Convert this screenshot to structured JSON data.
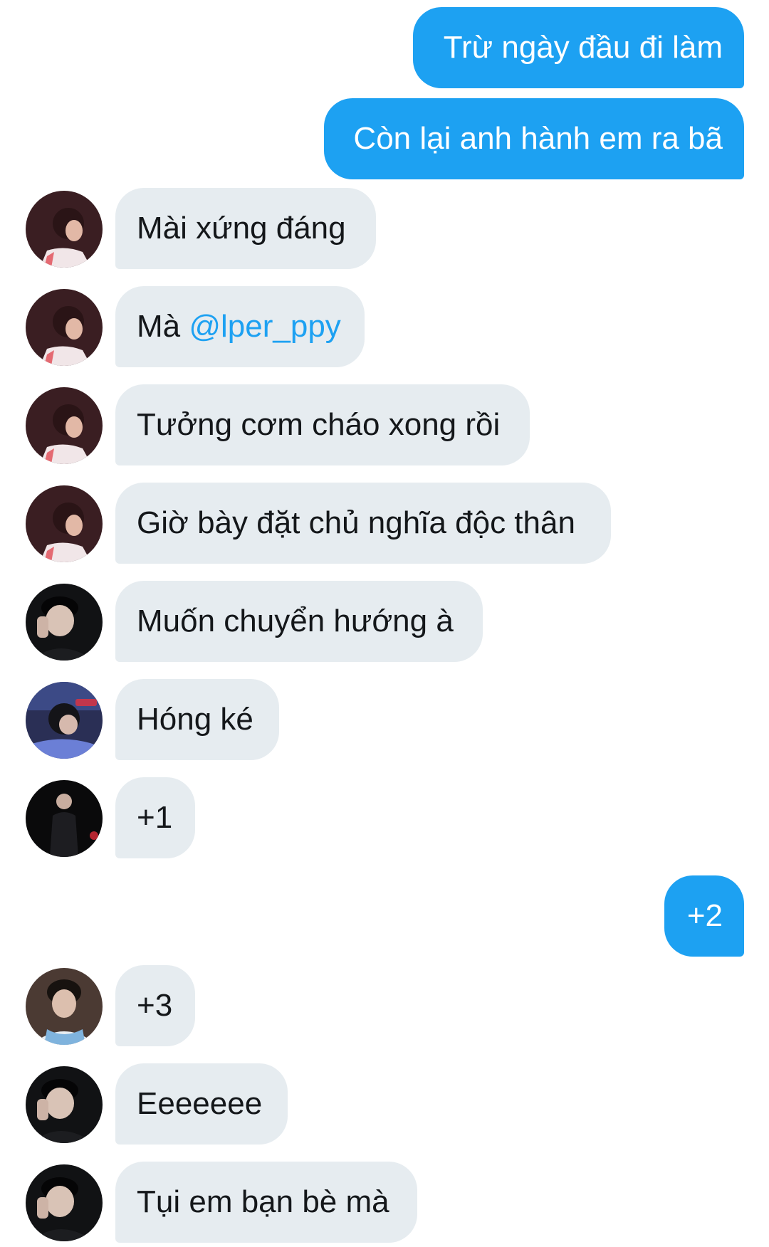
{
  "messages": [
    {
      "side": "out",
      "text": "Trừ ngày đầu đi làm"
    },
    {
      "side": "out",
      "text": "Còn lại anh hành em ra bã"
    },
    {
      "side": "in",
      "avatar": "user-a-avatar",
      "text": "Mài xứng đáng"
    },
    {
      "side": "in",
      "avatar": "user-a-avatar",
      "text_prefix": "Mà ",
      "mention": "@lper_ppy"
    },
    {
      "side": "in",
      "avatar": "user-a-avatar",
      "text": "Tưởng cơm cháo xong rồi"
    },
    {
      "side": "in",
      "avatar": "user-a-avatar",
      "text": "Giờ bày đặt chủ nghĩa độc thân"
    },
    {
      "side": "in",
      "avatar": "user-b-avatar",
      "text": "Muốn chuyển hướng à"
    },
    {
      "side": "in",
      "avatar": "user-c-avatar",
      "text": "Hóng ké"
    },
    {
      "side": "in",
      "avatar": "user-d-avatar",
      "text": "+1"
    },
    {
      "side": "out",
      "text": "+2"
    },
    {
      "side": "in",
      "avatar": "user-e-avatar",
      "text": "+3"
    },
    {
      "side": "in",
      "avatar": "user-b-avatar",
      "text": "Eeeeeee"
    },
    {
      "side": "in",
      "avatar": "user-b-avatar",
      "text": "Tụi em bạn bè mà"
    }
  ],
  "colors": {
    "outgoing_bubble": "#1da1f2",
    "incoming_bubble": "#e6ecf0",
    "mention": "#1da1f2"
  }
}
